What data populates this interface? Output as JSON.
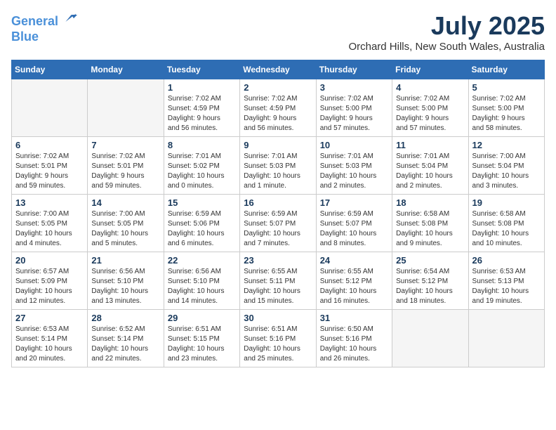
{
  "header": {
    "logo_line1": "General",
    "logo_line2": "Blue",
    "month_year": "July 2025",
    "location": "Orchard Hills, New South Wales, Australia"
  },
  "columns": [
    "Sunday",
    "Monday",
    "Tuesday",
    "Wednesday",
    "Thursday",
    "Friday",
    "Saturday"
  ],
  "weeks": [
    [
      {
        "day": "",
        "info": ""
      },
      {
        "day": "",
        "info": ""
      },
      {
        "day": "1",
        "info": "Sunrise: 7:02 AM\nSunset: 4:59 PM\nDaylight: 9 hours\nand 56 minutes."
      },
      {
        "day": "2",
        "info": "Sunrise: 7:02 AM\nSunset: 4:59 PM\nDaylight: 9 hours\nand 56 minutes."
      },
      {
        "day": "3",
        "info": "Sunrise: 7:02 AM\nSunset: 5:00 PM\nDaylight: 9 hours\nand 57 minutes."
      },
      {
        "day": "4",
        "info": "Sunrise: 7:02 AM\nSunset: 5:00 PM\nDaylight: 9 hours\nand 57 minutes."
      },
      {
        "day": "5",
        "info": "Sunrise: 7:02 AM\nSunset: 5:00 PM\nDaylight: 9 hours\nand 58 minutes."
      }
    ],
    [
      {
        "day": "6",
        "info": "Sunrise: 7:02 AM\nSunset: 5:01 PM\nDaylight: 9 hours\nand 59 minutes."
      },
      {
        "day": "7",
        "info": "Sunrise: 7:02 AM\nSunset: 5:01 PM\nDaylight: 9 hours\nand 59 minutes."
      },
      {
        "day": "8",
        "info": "Sunrise: 7:01 AM\nSunset: 5:02 PM\nDaylight: 10 hours\nand 0 minutes."
      },
      {
        "day": "9",
        "info": "Sunrise: 7:01 AM\nSunset: 5:03 PM\nDaylight: 10 hours\nand 1 minute."
      },
      {
        "day": "10",
        "info": "Sunrise: 7:01 AM\nSunset: 5:03 PM\nDaylight: 10 hours\nand 2 minutes."
      },
      {
        "day": "11",
        "info": "Sunrise: 7:01 AM\nSunset: 5:04 PM\nDaylight: 10 hours\nand 2 minutes."
      },
      {
        "day": "12",
        "info": "Sunrise: 7:00 AM\nSunset: 5:04 PM\nDaylight: 10 hours\nand 3 minutes."
      }
    ],
    [
      {
        "day": "13",
        "info": "Sunrise: 7:00 AM\nSunset: 5:05 PM\nDaylight: 10 hours\nand 4 minutes."
      },
      {
        "day": "14",
        "info": "Sunrise: 7:00 AM\nSunset: 5:05 PM\nDaylight: 10 hours\nand 5 minutes."
      },
      {
        "day": "15",
        "info": "Sunrise: 6:59 AM\nSunset: 5:06 PM\nDaylight: 10 hours\nand 6 minutes."
      },
      {
        "day": "16",
        "info": "Sunrise: 6:59 AM\nSunset: 5:07 PM\nDaylight: 10 hours\nand 7 minutes."
      },
      {
        "day": "17",
        "info": "Sunrise: 6:59 AM\nSunset: 5:07 PM\nDaylight: 10 hours\nand 8 minutes."
      },
      {
        "day": "18",
        "info": "Sunrise: 6:58 AM\nSunset: 5:08 PM\nDaylight: 10 hours\nand 9 minutes."
      },
      {
        "day": "19",
        "info": "Sunrise: 6:58 AM\nSunset: 5:08 PM\nDaylight: 10 hours\nand 10 minutes."
      }
    ],
    [
      {
        "day": "20",
        "info": "Sunrise: 6:57 AM\nSunset: 5:09 PM\nDaylight: 10 hours\nand 12 minutes."
      },
      {
        "day": "21",
        "info": "Sunrise: 6:56 AM\nSunset: 5:10 PM\nDaylight: 10 hours\nand 13 minutes."
      },
      {
        "day": "22",
        "info": "Sunrise: 6:56 AM\nSunset: 5:10 PM\nDaylight: 10 hours\nand 14 minutes."
      },
      {
        "day": "23",
        "info": "Sunrise: 6:55 AM\nSunset: 5:11 PM\nDaylight: 10 hours\nand 15 minutes."
      },
      {
        "day": "24",
        "info": "Sunrise: 6:55 AM\nSunset: 5:12 PM\nDaylight: 10 hours\nand 16 minutes."
      },
      {
        "day": "25",
        "info": "Sunrise: 6:54 AM\nSunset: 5:12 PM\nDaylight: 10 hours\nand 18 minutes."
      },
      {
        "day": "26",
        "info": "Sunrise: 6:53 AM\nSunset: 5:13 PM\nDaylight: 10 hours\nand 19 minutes."
      }
    ],
    [
      {
        "day": "27",
        "info": "Sunrise: 6:53 AM\nSunset: 5:14 PM\nDaylight: 10 hours\nand 20 minutes."
      },
      {
        "day": "28",
        "info": "Sunrise: 6:52 AM\nSunset: 5:14 PM\nDaylight: 10 hours\nand 22 minutes."
      },
      {
        "day": "29",
        "info": "Sunrise: 6:51 AM\nSunset: 5:15 PM\nDaylight: 10 hours\nand 23 minutes."
      },
      {
        "day": "30",
        "info": "Sunrise: 6:51 AM\nSunset: 5:16 PM\nDaylight: 10 hours\nand 25 minutes."
      },
      {
        "day": "31",
        "info": "Sunrise: 6:50 AM\nSunset: 5:16 PM\nDaylight: 10 hours\nand 26 minutes."
      },
      {
        "day": "",
        "info": ""
      },
      {
        "day": "",
        "info": ""
      }
    ]
  ]
}
